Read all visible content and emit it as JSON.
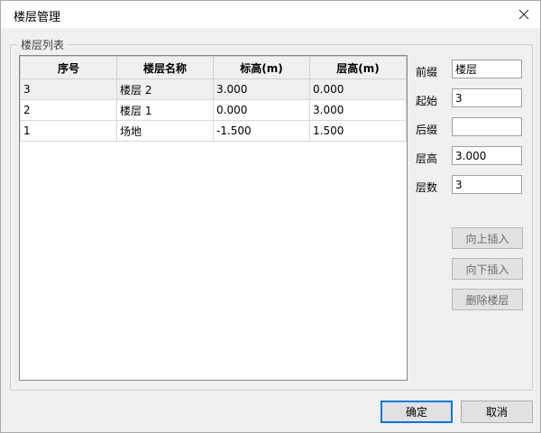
{
  "window": {
    "title": "楼层管理"
  },
  "group": {
    "legend": "楼层列表"
  },
  "table": {
    "headers": [
      "序号",
      "楼层名称",
      "标高(m)",
      "层高(m)"
    ],
    "rows": [
      [
        "3",
        "楼层 2",
        "3.000",
        "0.000"
      ],
      [
        "2",
        "楼层 1",
        "0.000",
        "3.000"
      ],
      [
        "1",
        "场地",
        "-1.500",
        "1.500"
      ]
    ]
  },
  "form": {
    "prefix": {
      "label": "前缀",
      "value": "楼层"
    },
    "start": {
      "label": "起始",
      "value": "3"
    },
    "suffix": {
      "label": "后缀",
      "value": ""
    },
    "height": {
      "label": "层高",
      "value": "3.000"
    },
    "count": {
      "label": "层数",
      "value": "3"
    }
  },
  "side_buttons": {
    "insert_above": "向上插入",
    "insert_below": "向下插入",
    "delete": "删除楼层"
  },
  "dialog_buttons": {
    "ok": "确定",
    "cancel": "取消"
  },
  "icons": {
    "close": "close-icon"
  }
}
